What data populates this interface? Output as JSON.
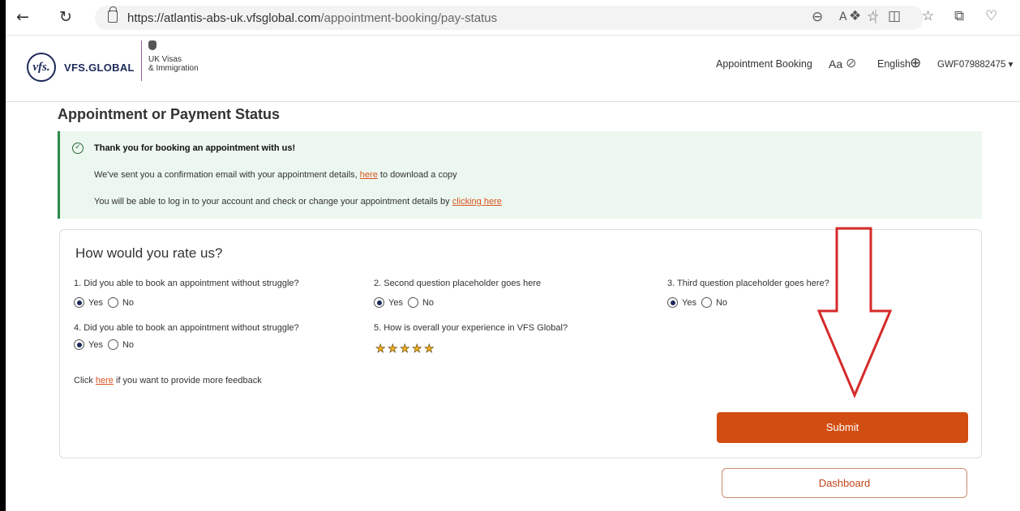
{
  "browser": {
    "url_host": "https://atlantis-abs-uk.vfsglobal.com",
    "url_path": "/appointment-booking/pay-status",
    "back_icon": "back-arrow-icon",
    "refresh_icon": "refresh-icon"
  },
  "header": {
    "logo_mark": "vfs.",
    "logo_text": "VFS.GLOBAL",
    "partner_line1": "UK Visas",
    "partner_line2": "& Immigration",
    "nav_appointment": "Appointment Booking",
    "text_size_label": "Aa",
    "language": "English",
    "account": "GWF079882475 ▾"
  },
  "page": {
    "title": "Appointment or Payment Status"
  },
  "alert": {
    "title": "Thank you for booking an appointment with us!",
    "line1_prefix": "We've sent you a confirmation email with your appointment details,",
    "line1_link": "here",
    "line1_suffix": "to download a copy",
    "line2_prefix": "You will be able to log in to your account and check or change your appointment details by",
    "line2_link": "clicking here",
    "color": "#2a8a4a"
  },
  "rating": {
    "title": "How would you rate us?",
    "questions": [
      {
        "text": "1. Did you able to book an appointment without struggle?",
        "yes": "Yes",
        "no": "No",
        "selected": "Yes"
      },
      {
        "text": "2. Second question placeholder goes here",
        "yes": "Yes",
        "no": "No",
        "selected": "Yes"
      },
      {
        "text": "3. Third question placeholder goes here?",
        "yes": "Yes",
        "no": "No",
        "selected": "Yes"
      },
      {
        "text": "4. Did you able to book an appointment without struggle?",
        "yes": "Yes",
        "no": "No",
        "selected": "Yes"
      }
    ],
    "q5": "5. How is overall your experience in VFS Global?",
    "stars": 5,
    "feedback_prefix": "Click",
    "feedback_link": "here",
    "feedback_suffix": "if you want to provide more feedback",
    "submit_label": "Submit",
    "submit_color": "#d24d11"
  },
  "dashboard_label": "Dashboard",
  "annotation": {
    "arrow_color": "#d62a2a"
  }
}
